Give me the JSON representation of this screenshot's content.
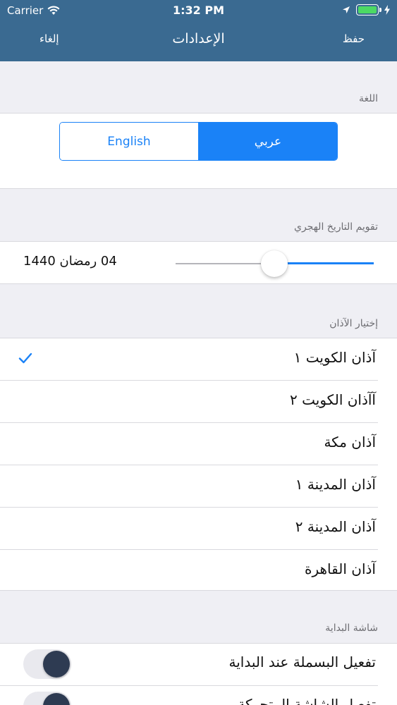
{
  "status_bar": {
    "carrier": "Carrier",
    "time": "1:32 PM",
    "battery_color": "#4cd964"
  },
  "nav": {
    "title": "الإعدادات",
    "left_label": "إلغاء",
    "right_label": "حفظ",
    "background": "#3a6a91"
  },
  "language": {
    "section_label": "اللغة",
    "options": [
      "English",
      "عربي"
    ],
    "selected": "عربي",
    "accent": "#1a82f7"
  },
  "hijri": {
    "section_label": "تقويم التاريخ الهجري",
    "date_text": "04 رمضان 1440"
  },
  "adhan": {
    "section_label": "إختيار الآذان",
    "items": [
      {
        "label": "آذان الكويت ١",
        "selected": true
      },
      {
        "label": "آآذان الكويت ٢",
        "selected": false
      },
      {
        "label": "آذان مكة",
        "selected": false
      },
      {
        "label": "آذان المدينة ١",
        "selected": false
      },
      {
        "label": "آذان المدينة ٢",
        "selected": false
      },
      {
        "label": "آذان القاهرة",
        "selected": false
      }
    ]
  },
  "startup": {
    "section_label": "شاشة البداية",
    "items": [
      {
        "label": "تفعيل البسملة عند البداية",
        "enabled": true
      },
      {
        "label": "تفعيل الشاشة المتحركة",
        "enabled": true
      }
    ]
  }
}
